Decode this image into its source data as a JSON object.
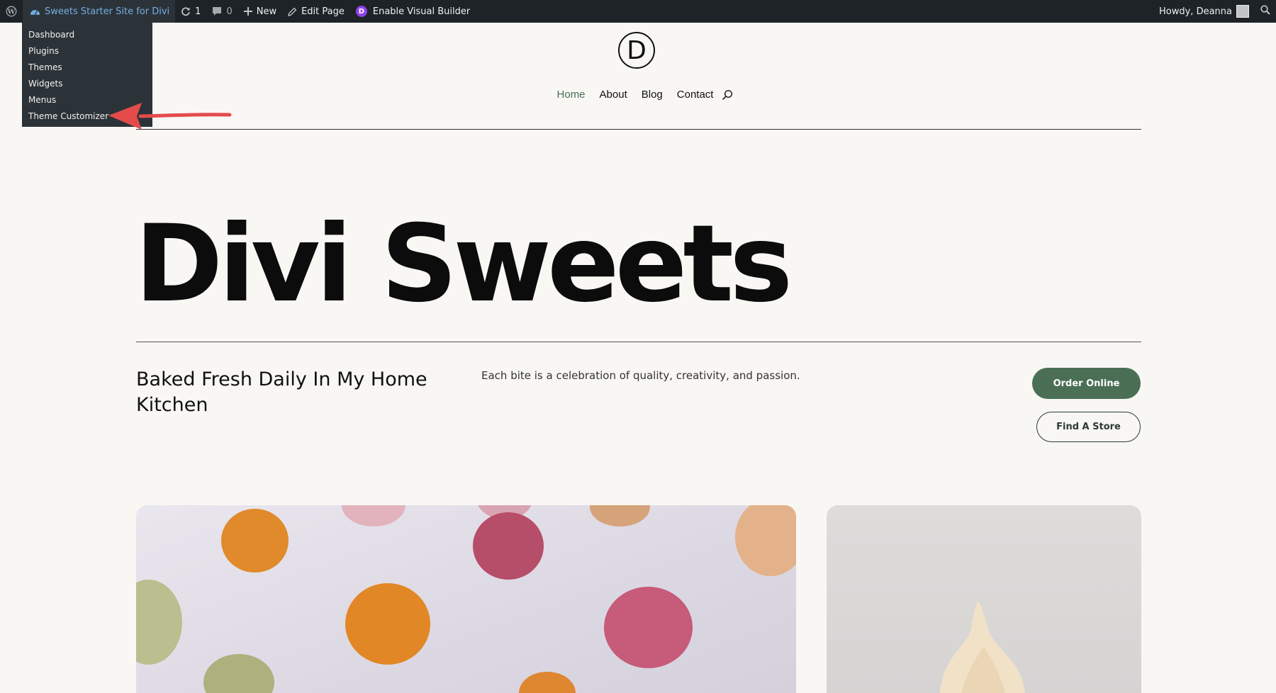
{
  "admin_bar": {
    "site_name": "Sweets Starter Site for Divi",
    "updates_count": "1",
    "comments_count": "0",
    "new_label": "New",
    "edit_label": "Edit Page",
    "visual_builder_label": "Enable Visual Builder",
    "greeting": "Howdy, Deanna",
    "dropdown_items": [
      "Dashboard",
      "Plugins",
      "Themes",
      "Widgets",
      "Menus",
      "Theme Customizer"
    ]
  },
  "header": {
    "logo_letter": "D",
    "nav": [
      "Home",
      "About",
      "Blog",
      "Contact"
    ]
  },
  "hero": {
    "title": "Divi Sweets",
    "tagline": "Baked Fresh Daily In My Home Kitchen",
    "description": "Each bite is a celebration of quality, creativity, and passion.",
    "primary_button": "Order Online",
    "secondary_button": "Find A Store"
  },
  "colors": {
    "admin_bar_bg": "#1d2327",
    "accent_green": "#4b6f55",
    "page_bg": "#f8f7f4",
    "annotation_arrow": "#e54b4b"
  }
}
